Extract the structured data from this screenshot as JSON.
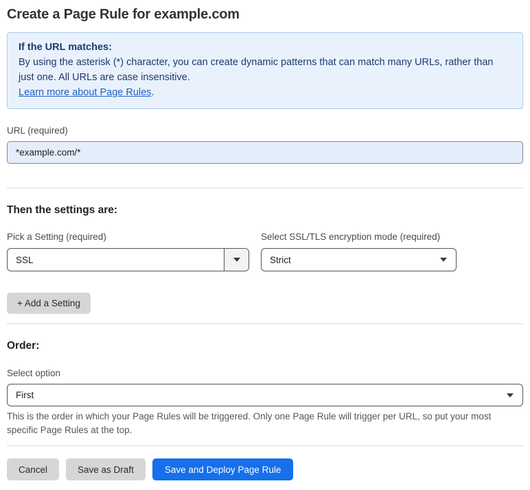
{
  "page": {
    "title": "Create a Page Rule for example.com"
  },
  "info_box": {
    "heading": "If the URL matches:",
    "body": "By using the asterisk (*) character, you can create dynamic patterns that can match many URLs, rather than just one. All URLs are case insensitive.",
    "link_label": "Learn more about Page Rules",
    "link_suffix": "."
  },
  "url_field": {
    "label": "URL (required)",
    "value": "*example.com/*"
  },
  "settings_section": {
    "heading": "Then the settings are:",
    "setting_picker": {
      "label": "Pick a Setting (required)",
      "value": "SSL"
    },
    "ssl_mode": {
      "label": "Select SSL/TLS encryption mode (required)",
      "value": "Strict"
    },
    "add_setting_label": "+ Add a Setting"
  },
  "order_section": {
    "heading": "Order:",
    "select_label": "Select option",
    "value": "First",
    "help_text": "This is the order in which your Page Rules will be triggered. Only one Page Rule will trigger per URL, so put your most specific Page Rules at the top."
  },
  "footer": {
    "cancel_label": "Cancel",
    "save_draft_label": "Save as Draft",
    "save_deploy_label": "Save and Deploy Page Rule"
  },
  "colors": {
    "accent_blue": "#166FEB",
    "info_background": "#E9F2FC",
    "info_border": "#A9CBF2",
    "info_text": "#1B3B70",
    "link_blue": "#1D5FC7",
    "url_input_background": "#E4EEFB",
    "gray_button": "#D6D6D6"
  }
}
